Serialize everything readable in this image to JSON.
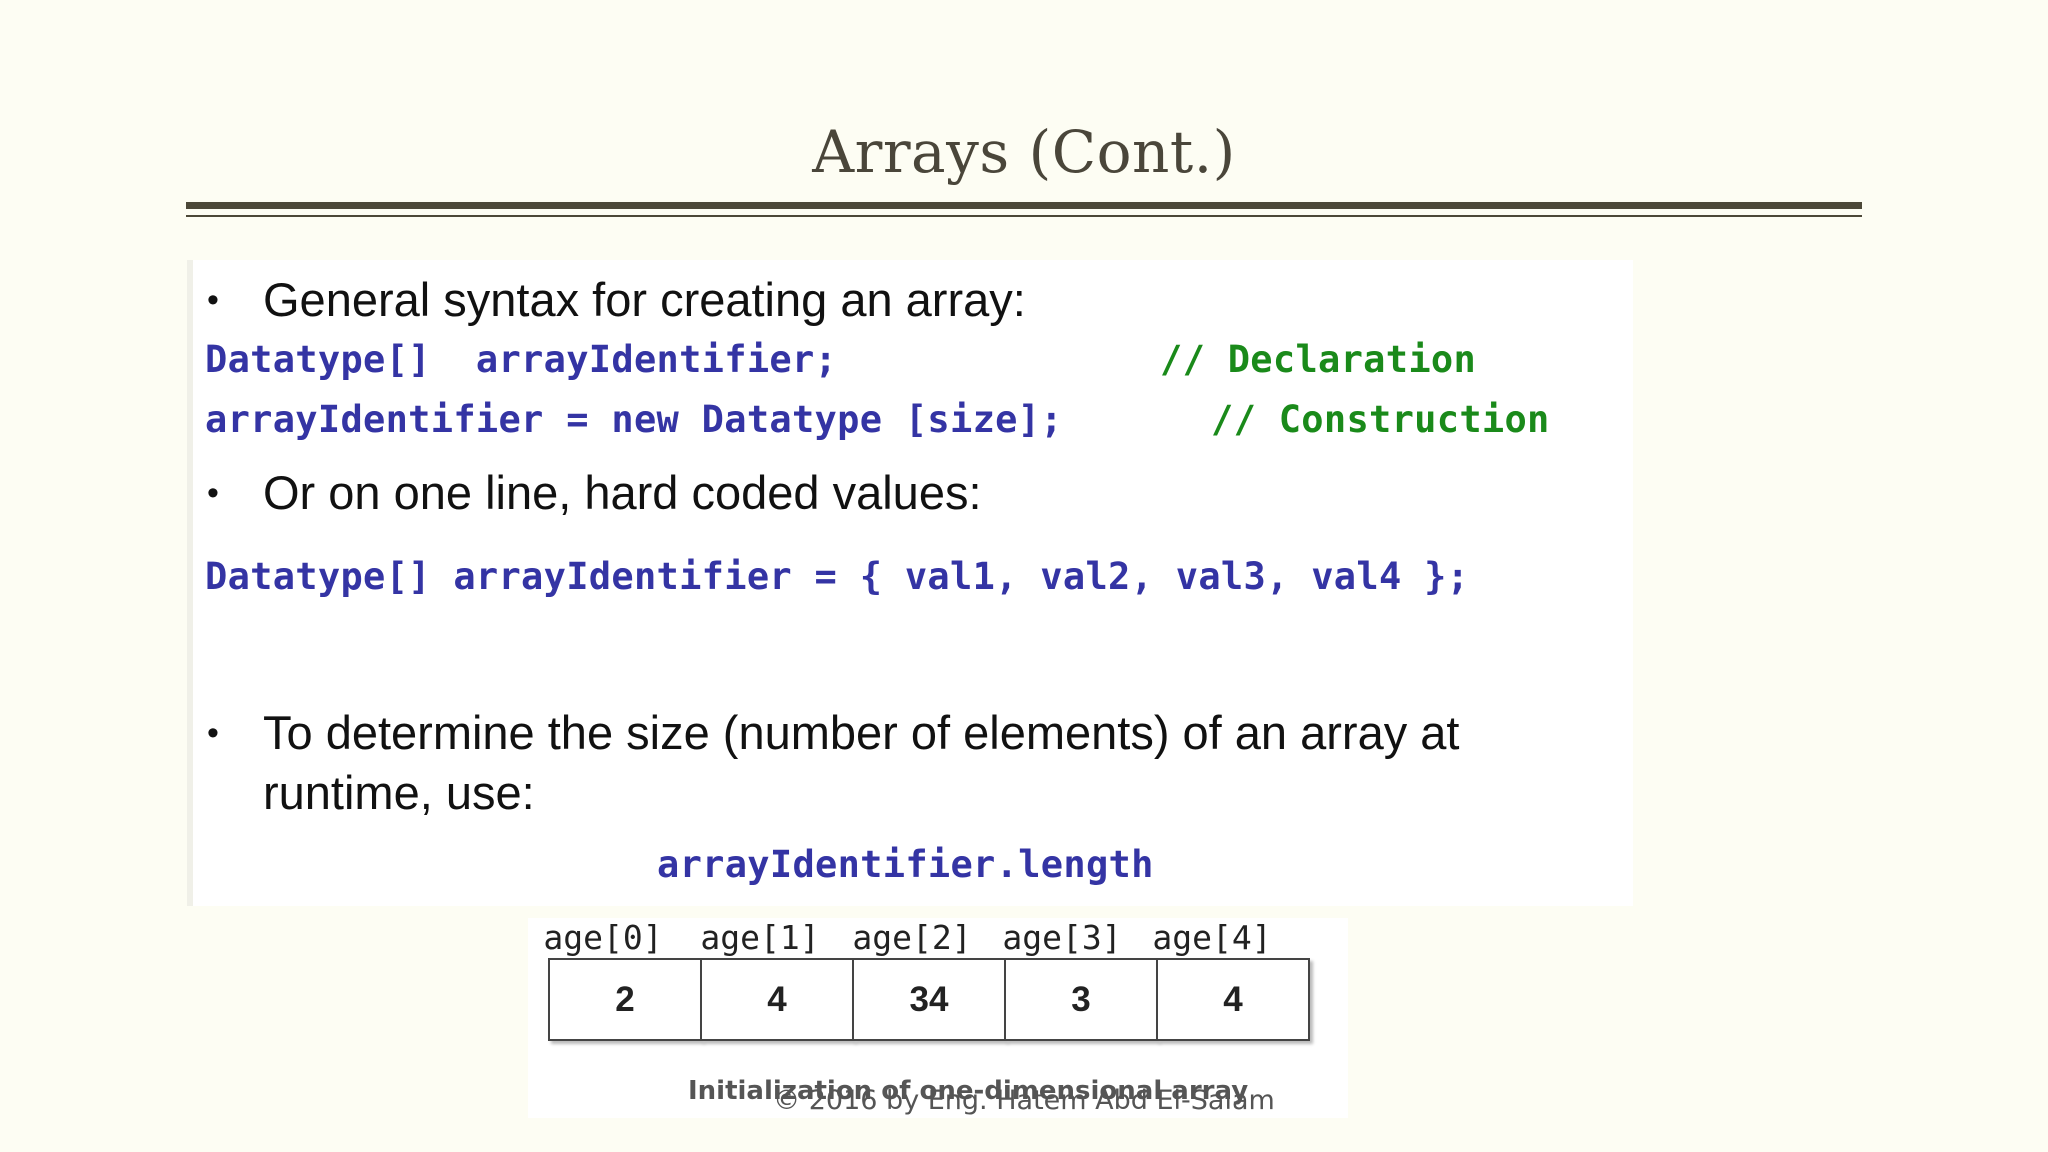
{
  "slide": {
    "title": "Arrays (Cont.)",
    "footer": "© 2016 by Eng. Hatem Abd El-Salam"
  },
  "bullets": [
    {
      "marker": "•",
      "text": "General syntax for creating an array:"
    },
    {
      "marker": "•",
      "text": "Or on one line, hard coded values:"
    },
    {
      "marker": "•",
      "line1": "To determine the size (number of elements) of an array at",
      "line2": "runtime, use:"
    }
  ],
  "code": {
    "declaration": "Datatype[]  arrayIdentifier;",
    "declaration_comment": "// Declaration",
    "construction": "arrayIdentifier = new Datatype [size];",
    "construction_comment": "// Construction",
    "one_line": "Datatype[] arrayIdentifier = { val1, val2, val3, val4 };",
    "length": "arrayIdentifier.length"
  },
  "array_figure": {
    "labels": [
      "age[0]",
      "age[1]",
      "age[2]",
      "age[3]",
      "age[4]"
    ],
    "values": [
      "2",
      "4",
      "34",
      "3",
      "4"
    ],
    "caption": "Initialization of one-dimensional array"
  }
}
